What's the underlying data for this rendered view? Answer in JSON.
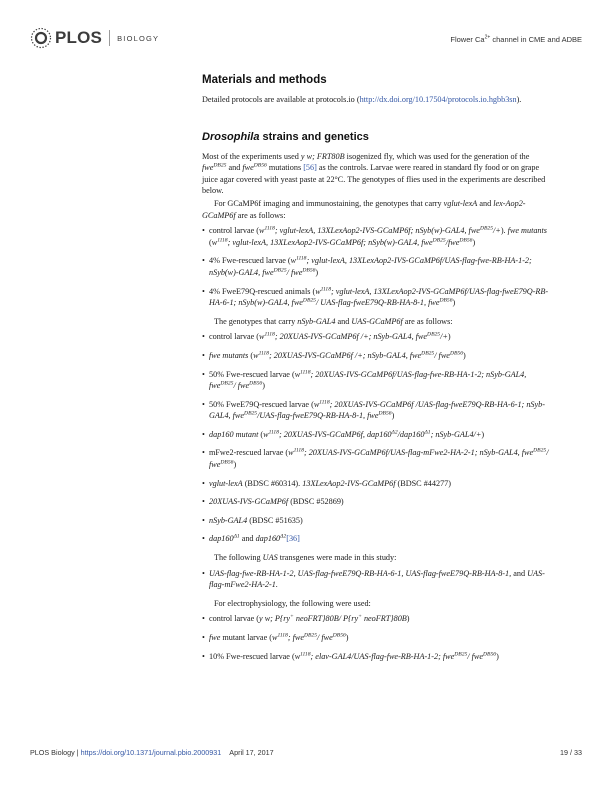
{
  "header": {
    "logo_text": "PLOS",
    "journal": "BIOLOGY",
    "running_title_pre": "Flower Ca",
    "running_title_sup": "2+",
    "running_title_post": " channel in CME and ADBE"
  },
  "section": {
    "title": "Materials and methods",
    "intro_pre": "Detailed protocols are available at protocols.io (",
    "intro_link": "http://dx.doi.org/10.17504/protocols.io.hgbb3sn",
    "intro_post": ")."
  },
  "subsection": {
    "title_italic": "Drosophila",
    "title_rest": " strains and genetics"
  },
  "footer": {
    "journal": "PLOS Biology",
    "sep": " | ",
    "doi": "https://doi.org/10.1371/journal.pbio.2000931",
    "date": "April 17, 2017",
    "page": "19 / 33"
  }
}
